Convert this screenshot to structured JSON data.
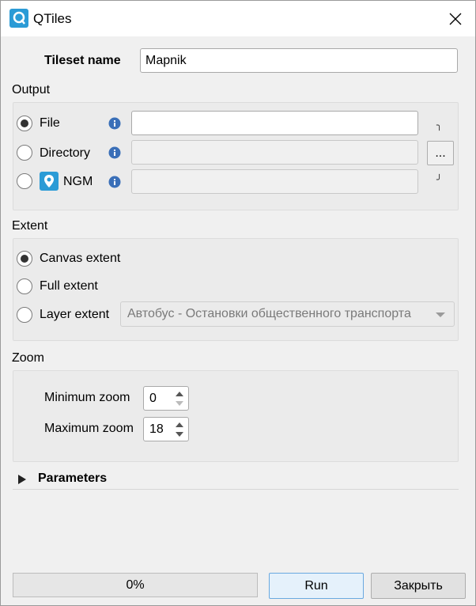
{
  "window": {
    "title": "QTiles"
  },
  "tileset": {
    "label": "Tileset name",
    "value": "Mapnik"
  },
  "output": {
    "title": "Output",
    "options": [
      {
        "label": "File",
        "selected": true,
        "value": ""
      },
      {
        "label": "Directory",
        "selected": false,
        "value": ""
      },
      {
        "label": "NGM",
        "selected": false,
        "value": ""
      }
    ],
    "browse_label": "..."
  },
  "extent": {
    "title": "Extent",
    "options": [
      {
        "label": "Canvas extent",
        "selected": true
      },
      {
        "label": "Full extent",
        "selected": false
      },
      {
        "label": "Layer extent",
        "selected": false
      }
    ],
    "layer_selected": "Автобус - Остановки общественного транспорта"
  },
  "zoom": {
    "title": "Zoom",
    "min_label": "Minimum zoom",
    "min_value": "0",
    "max_label": "Maximum zoom",
    "max_value": "18"
  },
  "parameters": {
    "label": "Parameters"
  },
  "footer": {
    "progress_text": "0%",
    "progress": 0,
    "run_label": "Run",
    "close_label": "Закрыть"
  },
  "colors": {
    "accent": "#2b9bd6",
    "default_button_border": "#6aa9e0"
  }
}
